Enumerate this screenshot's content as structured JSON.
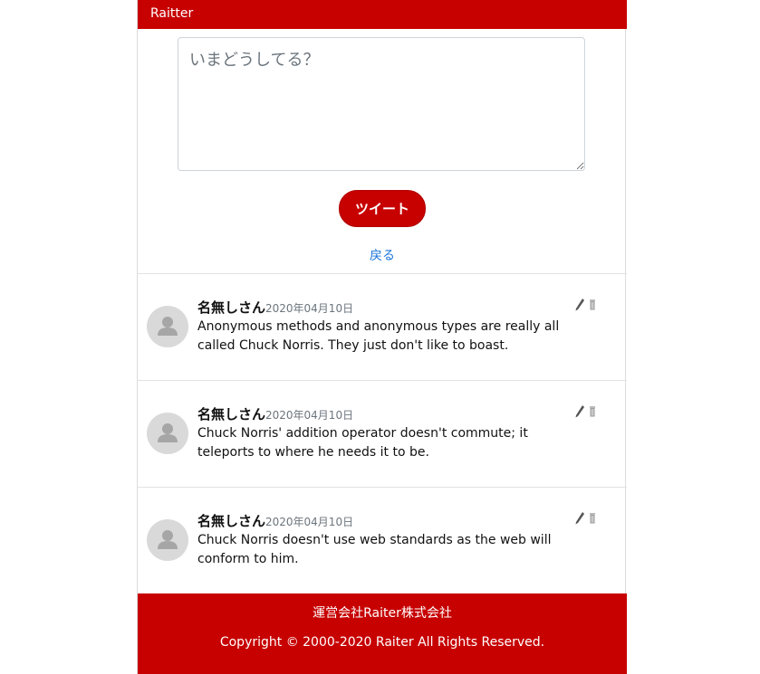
{
  "navbar": {
    "brand": "Raitter"
  },
  "compose": {
    "placeholder": "いまどうしてる？",
    "value": "",
    "tweet_button": "ツイート",
    "back_link": "戻る"
  },
  "posts": [
    {
      "author": "名無しさん",
      "date": "2020年04月10日",
      "body": "Anonymous methods and anonymous types are really all called Chuck Norris. They just don't like to boast."
    },
    {
      "author": "名無しさん",
      "date": "2020年04月10日",
      "body": "Chuck Norris' addition operator doesn't commute; it teleports to where he needs it to be."
    },
    {
      "author": "名無しさん",
      "date": "2020年04月10日",
      "body": "Chuck Norris doesn't use web standards as the web will conform to him."
    }
  ],
  "icons": {
    "edit": "pencil-icon",
    "delete": "trash-icon"
  },
  "footer": {
    "company": "運営会社Raiter株式会社",
    "copyright": "Copyright © 2000-2020 Raiter All Rights Reserved."
  },
  "colors": {
    "brand": "#c70000",
    "link": "#1a73d9",
    "muted": "#6c757d"
  }
}
